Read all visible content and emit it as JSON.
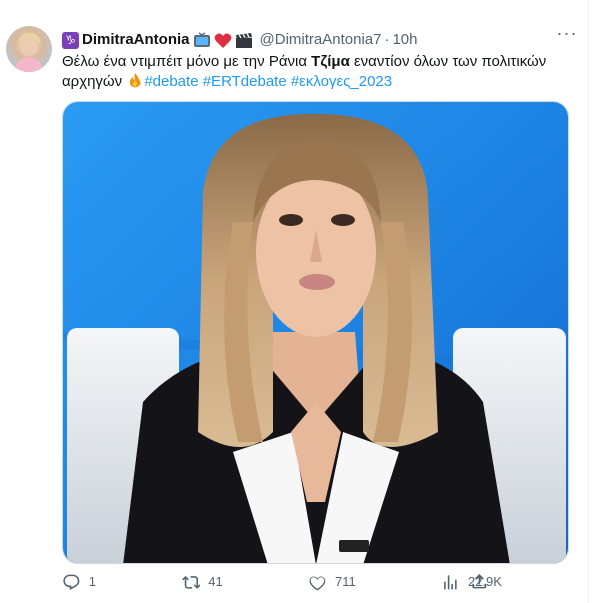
{
  "tweet": {
    "display_name": "DimitraAntonia",
    "zodiac_badge": "♑",
    "handle": "@DimitraAntonia7",
    "separator": "·",
    "time": "10h",
    "more_glyph": "···",
    "text_part1": "Θέλω ένα ντιμπέιτ μόνο με την Ράνια ",
    "text_bold": "Τζίμα",
    "text_part2": " εναντίον όλων των πολιτικών αρχηγών",
    "hashtags": [
      "#debate",
      "#ERTdebate",
      "#εκλογες_2023"
    ],
    "icons": [
      "tv-emoji",
      "red-heart-emoji",
      "clapper-board-emoji",
      "fire-emoji"
    ]
  },
  "actions": {
    "replies": "1",
    "retweets": "41",
    "likes": "711",
    "views": "22.9K"
  },
  "colors": {
    "link": "#1d9bf0",
    "muted": "#536471",
    "text": "#0f1419",
    "media_background": "#1e88e5"
  }
}
